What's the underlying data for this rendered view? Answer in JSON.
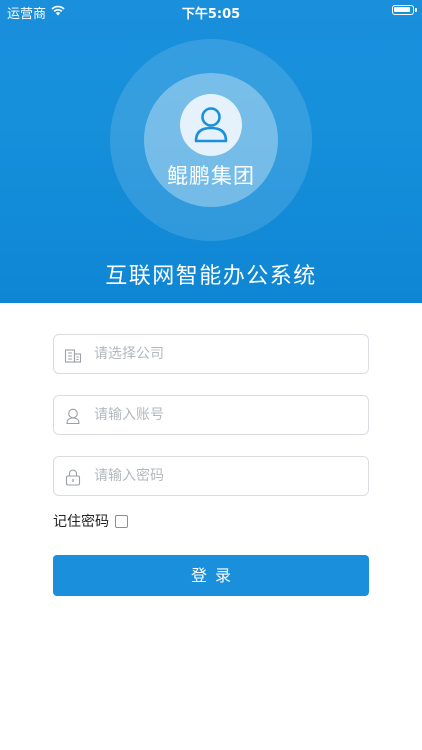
{
  "status_bar": {
    "carrier": "运营商",
    "time": "下午5:05",
    "wifi_icon": "wifi-icon",
    "battery_icon": "battery-icon"
  },
  "hero": {
    "avatar_icon": "user-icon",
    "company_name": "鲲鹏集团",
    "app_title": "互联网智能办公系统"
  },
  "form": {
    "company": {
      "icon": "building-icon",
      "placeholder": "请选择公司",
      "value": ""
    },
    "account": {
      "icon": "user-icon",
      "placeholder": "请输入账号",
      "value": ""
    },
    "password": {
      "icon": "lock-icon",
      "placeholder": "请输入密码",
      "value": ""
    },
    "remember_label": "记住密码",
    "remember_checked": false,
    "login_label": "登录"
  },
  "colors": {
    "primary": "#1a8fdc",
    "border": "#d9dde2",
    "placeholder": "#b3b8be"
  }
}
